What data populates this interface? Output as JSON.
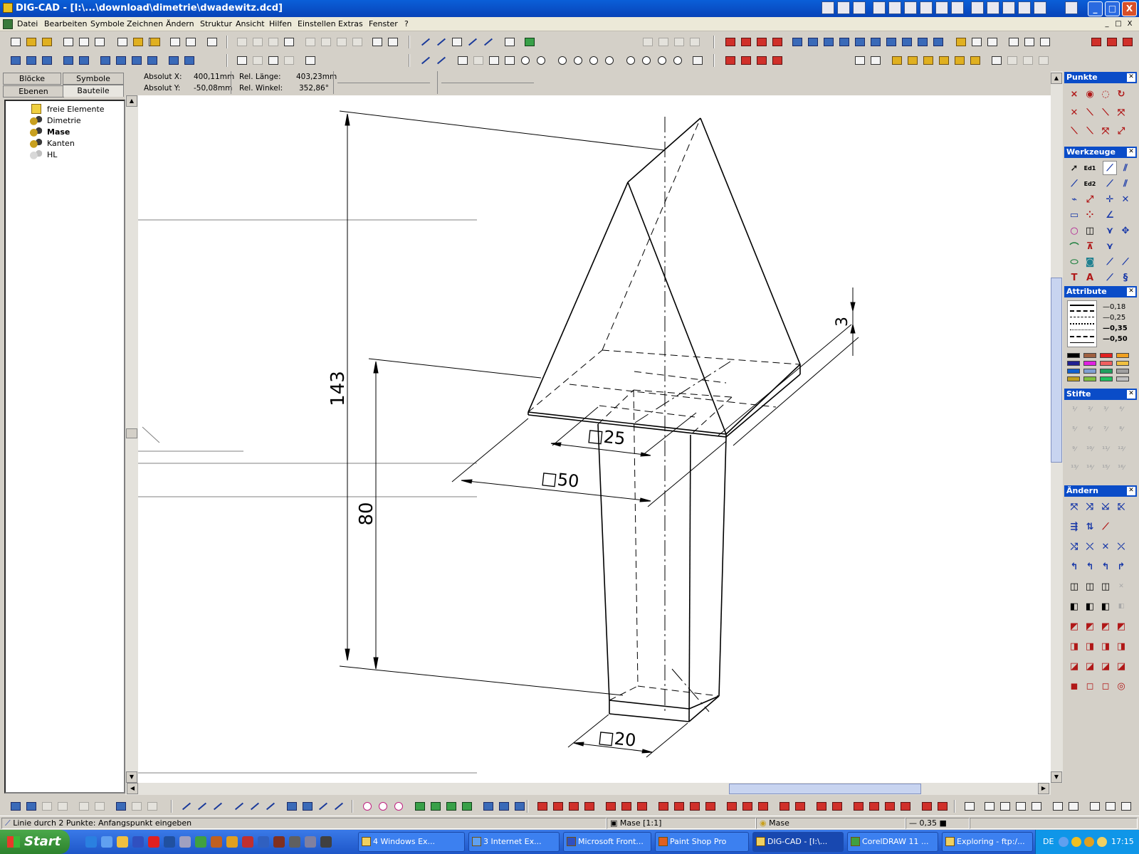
{
  "title": "DIG-CAD - [I:\\...\\download\\dimetrie\\dwadewitz.dcd]",
  "menu": [
    "Datei",
    "Bearbeiten",
    "Symbole",
    "Zeichnen",
    "Ändern",
    "Struktur",
    "Ansicht",
    "Hilfen",
    "Einstellen",
    "Extras",
    "Fenster",
    "?"
  ],
  "left_tabs": {
    "row1": [
      "Blöcke",
      "Symbole"
    ],
    "row2": [
      "Ebenen",
      "Bauteile"
    ]
  },
  "tree": [
    "freie Elemente",
    "Dimetrie",
    "Mase",
    "Kanten",
    "HL"
  ],
  "coords": {
    "abs_x_label": "Absolut X:",
    "abs_x": "400,11mm",
    "abs_y_label": "Absolut Y:",
    "abs_y": "-50,08mm",
    "rel_len_label": "Rel. Länge:",
    "rel_len": "403,23mm",
    "rel_ang_label": "Rel. Winkel:",
    "rel_ang": "352,86°"
  },
  "drawing": {
    "dim_143": "143",
    "dim_80": "80",
    "dim_3": "3",
    "dim_25": "□25",
    "dim_50": "□50",
    "dim_20": "□20"
  },
  "panels": {
    "punkte": "Punkte",
    "werkzeuge": "Werkzeuge",
    "attribute": "Attribute",
    "stifte": "Stifte",
    "aendern": "Ändern"
  },
  "line_widths": [
    "0,18",
    "0,25",
    "0,35",
    "0,50"
  ],
  "palette": [
    "#000000",
    "#a06040",
    "#e02020",
    "#f0a020",
    "#202090",
    "#e020e0",
    "#f06060",
    "#f0c040",
    "#1060d0",
    "#80a0d0",
    "#20a060",
    "#a0a0a0",
    "#c0a020",
    "#80c040",
    "#20c060",
    "#c0c0c0"
  ],
  "status": {
    "hint": "Linie durch 2 Punkte: Anfangspunkt eingeben",
    "layer": "Mase [1:1]",
    "component": "Mase",
    "pen": "0,35"
  },
  "taskbar": {
    "start": "Start",
    "tasks": [
      "4 Windows Ex...",
      "3 Internet Ex...",
      "Microsoft Front...",
      "Paint Shop Pro",
      "DIG-CAD - [I:\\...",
      "CorelDRAW 11 ...",
      "Exploring - ftp:/..."
    ],
    "lang": "DE",
    "clock": "17:15"
  },
  "window_buttons": [
    "_",
    "□",
    "X"
  ],
  "mdi_buttons": [
    "_",
    "□",
    "X"
  ]
}
